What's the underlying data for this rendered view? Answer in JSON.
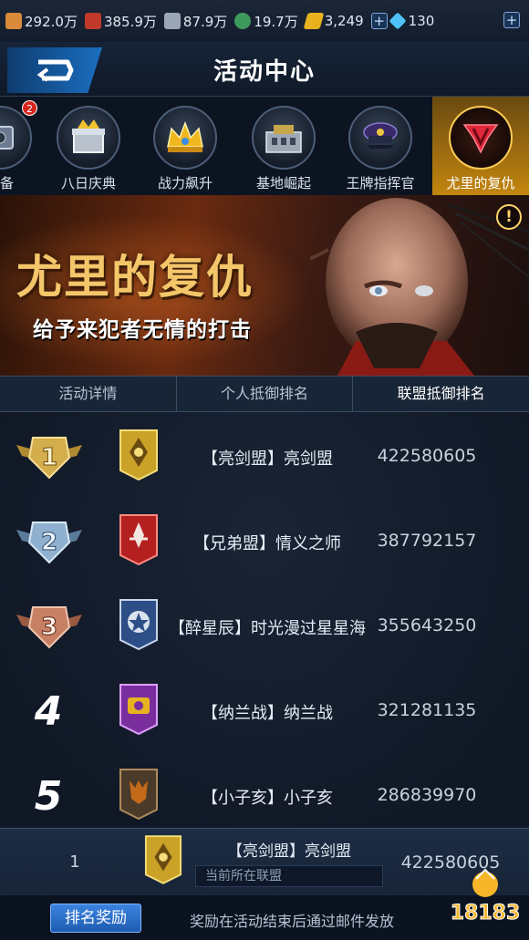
{
  "resources": [
    {
      "icon": "wood-icon",
      "value": "292.0万",
      "color": "#d98a3a"
    },
    {
      "icon": "ore-icon",
      "value": "385.9万",
      "color": "#c0392b"
    },
    {
      "icon": "steel-icon",
      "value": "87.9万",
      "color": "#9aa6b4"
    },
    {
      "icon": "oil-icon",
      "value": "19.7万",
      "color": "#3d9a5c"
    },
    {
      "icon": "gold-icon",
      "value": "3,249",
      "color": "#e8b21f"
    },
    {
      "icon": "diamond-icon",
      "value": "130",
      "color": "#4fc3f7"
    }
  ],
  "header": {
    "title": "活动中心"
  },
  "tabs": [
    {
      "label": "储备",
      "icon": "vault-icon"
    },
    {
      "label": "八日庆典",
      "icon": "gift-box-icon",
      "badge": "2"
    },
    {
      "label": "战力飙升",
      "icon": "crown-icon"
    },
    {
      "label": "基地崛起",
      "icon": "building-icon"
    },
    {
      "label": "王牌指挥官",
      "icon": "officer-cap-icon"
    },
    {
      "label": "尤里的复仇",
      "icon": "yuri-emblem-icon",
      "active": true
    }
  ],
  "banner": {
    "title": "尤里的复仇",
    "subtitle": "给予来犯者无情的打击",
    "info": "!"
  },
  "subtabs": [
    "活动详情",
    "个人抵御排名",
    "联盟抵御排名"
  ],
  "rankings": [
    {
      "rank": "1",
      "name": "【亮剑盟】亮剑盟",
      "score": "422580605",
      "flag_color": "#c9a227",
      "medal": "gold"
    },
    {
      "rank": "2",
      "name": "【兄弟盟】情义之师",
      "score": "387792157",
      "flag_color": "#b3201f",
      "medal": "silver"
    },
    {
      "rank": "3",
      "name": "【醉星辰】时光漫过星星海",
      "score": "355643250",
      "flag_color": "#2d4e86",
      "medal": "bronze"
    },
    {
      "rank": "4",
      "name": "【纳兰战】纳兰战",
      "score": "321281135",
      "flag_color": "#7a2e9e",
      "medal": ""
    },
    {
      "rank": "5",
      "name": "【小子亥】小子亥",
      "score": "286839970",
      "flag_color": "#4a3a2a",
      "medal": ""
    }
  ],
  "my_alliance": {
    "rank": "1",
    "name": "【亮剑盟】亮剑盟",
    "note": "当前所在联盟",
    "score": "422580605"
  },
  "footer": {
    "reward_button": "排名奖励",
    "note": "奖励在活动结束后通过邮件发放"
  },
  "watermark": "18183",
  "colors": {
    "active_tab": "#c4860f",
    "accent_blue": "#1f5cb0",
    "gold_text": "#f4c66a"
  }
}
